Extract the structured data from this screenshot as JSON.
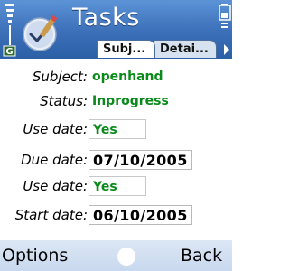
{
  "header": {
    "title": "Tasks",
    "icon": "tasks-app-icon",
    "indicator_letter": "G",
    "accent": "#3b6fb8"
  },
  "tabs": [
    {
      "label": "Subj...",
      "active": true
    },
    {
      "label": "Detai...",
      "active": false
    }
  ],
  "form": {
    "subject": {
      "label": "Subject:",
      "value": "openhand"
    },
    "status": {
      "label": "Status:",
      "value": "Inprogress"
    },
    "use_date_due": {
      "label": "Use date:",
      "value": "Yes"
    },
    "due_date": {
      "label": "Due date:",
      "value": "07/10/2005"
    },
    "use_date_start": {
      "label": "Use date:",
      "value": "Yes"
    },
    "start_date": {
      "label": "Start date:",
      "value": "06/10/2005"
    }
  },
  "softkeys": {
    "left": "Options",
    "right": "Back"
  },
  "colors": {
    "value_green": "#0a8a1a",
    "softkey_bar": "#c8d8ee"
  }
}
